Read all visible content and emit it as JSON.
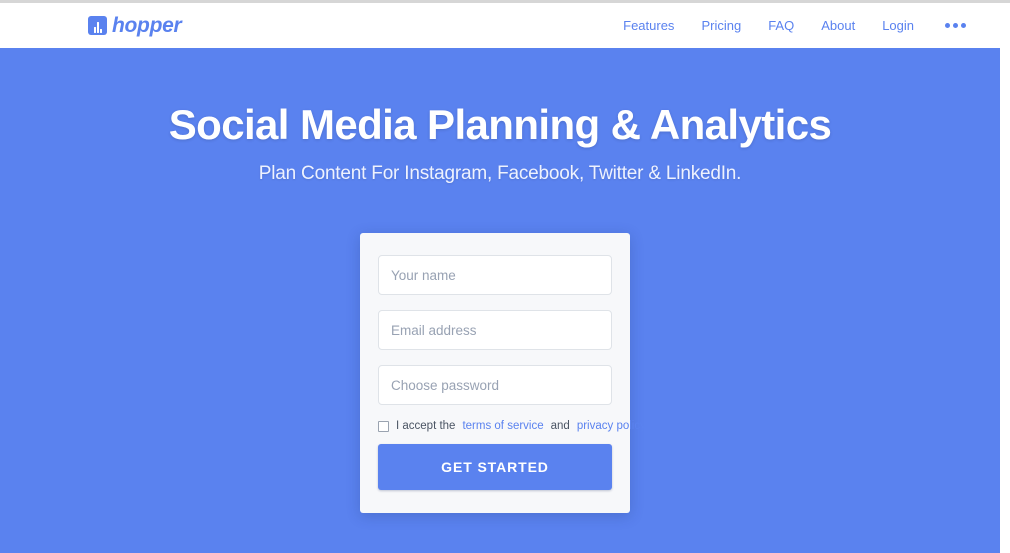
{
  "header": {
    "brand": {
      "name": "hopper",
      "icon": "bar-chart-square-icon",
      "color": "#5A82EF"
    },
    "nav_links": [
      {
        "label": "Features"
      },
      {
        "label": "Pricing"
      },
      {
        "label": "FAQ"
      },
      {
        "label": "About"
      },
      {
        "label": "Login"
      }
    ],
    "more_menu_icon": "ellipsis-horizontal-icon"
  },
  "hero": {
    "title": "Social Media Planning & Analytics",
    "subtitle": "Plan Content For Instagram, Facebook, Twitter & LinkedIn.",
    "background_color": "#5A82EF"
  },
  "signup_form": {
    "name_field": {
      "value": "",
      "placeholder": "Your name"
    },
    "email_field": {
      "value": "",
      "placeholder": "Email address"
    },
    "password_field": {
      "value": "",
      "placeholder": "Choose password"
    },
    "terms": {
      "checked": false,
      "prefix": "I accept the ",
      "terms_link": "terms of service",
      "conjunction": " and ",
      "privacy_link": "privacy policy"
    },
    "submit_label": "GET STARTED",
    "accent_color": "#5A82EF"
  }
}
